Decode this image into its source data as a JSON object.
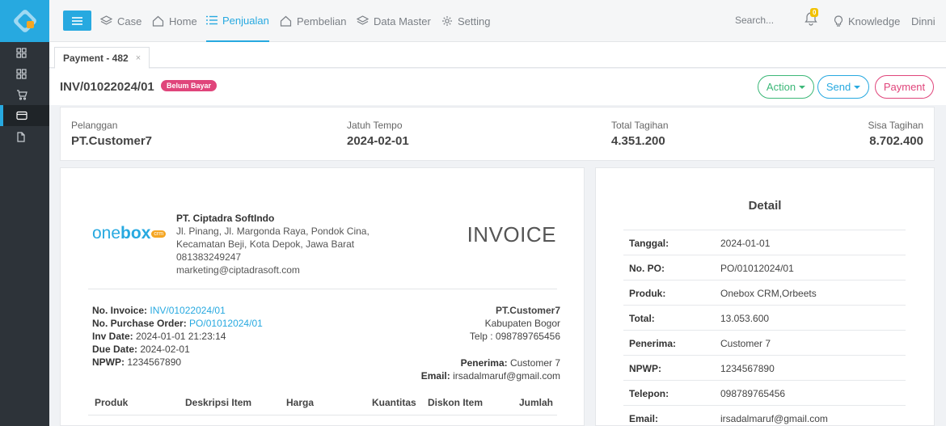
{
  "nav": {
    "items": [
      {
        "label": "Case",
        "icon": "layers-icon"
      },
      {
        "label": "Home",
        "icon": "home-icon"
      },
      {
        "label": "Penjualan",
        "icon": "list-icon",
        "active": true
      },
      {
        "label": "Pembelian",
        "icon": "home-icon"
      },
      {
        "label": "Data Master",
        "icon": "layers-icon"
      },
      {
        "label": "Setting",
        "icon": "gear-icon"
      }
    ],
    "search_label": "Search...",
    "notification_count": "0",
    "knowledge_label": "Knowledge",
    "user_name": "Dinni"
  },
  "tab": {
    "label": "Payment - 482",
    "close": "×"
  },
  "header": {
    "invoice_number": "INV/01022024/01",
    "status": "Belum Bayar",
    "action_label": "Action",
    "send_label": "Send",
    "payment_label": "Payment"
  },
  "summary": {
    "pelanggan_label": "Pelanggan",
    "pelanggan_value": "PT.Customer7",
    "jatuh_tempo_label": "Jatuh Tempo",
    "jatuh_tempo_value": "2024-02-01",
    "total_label": "Total Tagihan",
    "total_value": "4.351.200",
    "sisa_label": "Sisa Tagihan",
    "sisa_value": "8.702.400"
  },
  "invoice": {
    "logo_text_one": "one",
    "logo_text_box": "box",
    "logo_badge": "crm",
    "company_name": "PT. Ciptadra SoftIndo",
    "address_1": "Jl. Pinang, Jl. Margonda Raya, Pondok Cina,",
    "address_2": "Kecamatan Beji, Kota Depok, Jawa Barat",
    "phone": "081383249247",
    "email": "marketing@ciptadrasoft.com",
    "heading": "INVOICE",
    "no_invoice_label": "No. Invoice:",
    "no_invoice_value": "INV/01022024/01",
    "no_po_label": "No. Purchase Order:",
    "no_po_value": "PO/01012024/01",
    "inv_date_label": "Inv Date:",
    "inv_date_value": "2024-01-01 21:23:14",
    "due_date_label": "Due Date:",
    "due_date_value": "2024-02-01",
    "npwp_label": "NPWP:",
    "npwp_value": "1234567890",
    "customer_name": "PT.Customer7",
    "customer_city": "Kabupaten Bogor",
    "customer_phone": "Telp : 098789765456",
    "penerima_label": "Penerima:",
    "penerima_value": "Customer 7",
    "email_label": "Email:",
    "email_value": "irsadalmaruf@gmail.com",
    "table_headers": [
      "Produk",
      "Deskripsi Item",
      "Harga",
      "Kuantitas",
      "Diskon Item",
      "Jumlah"
    ]
  },
  "detail": {
    "title": "Detail",
    "rows": [
      {
        "key": "Tanggal:",
        "value": "2024-01-01"
      },
      {
        "key": "No. PO:",
        "value": "PO/01012024/01"
      },
      {
        "key": "Produk:",
        "value": "Onebox CRM,Orbeets"
      },
      {
        "key": "Total:",
        "value": "13.053.600"
      },
      {
        "key": "Penerima:",
        "value": "Customer 7"
      },
      {
        "key": "NPWP:",
        "value": "1234567890"
      },
      {
        "key": "Telepon:",
        "value": "098789765456"
      },
      {
        "key": "Email:",
        "value": "irsadalmaruf@gmail.com"
      }
    ]
  },
  "colors": {
    "accent": "#27a9e0",
    "status": "#e0457b",
    "action": "#3cb878",
    "send": "#27a9e0",
    "payment": "#e0457b",
    "sidebar": "#2d3339"
  }
}
